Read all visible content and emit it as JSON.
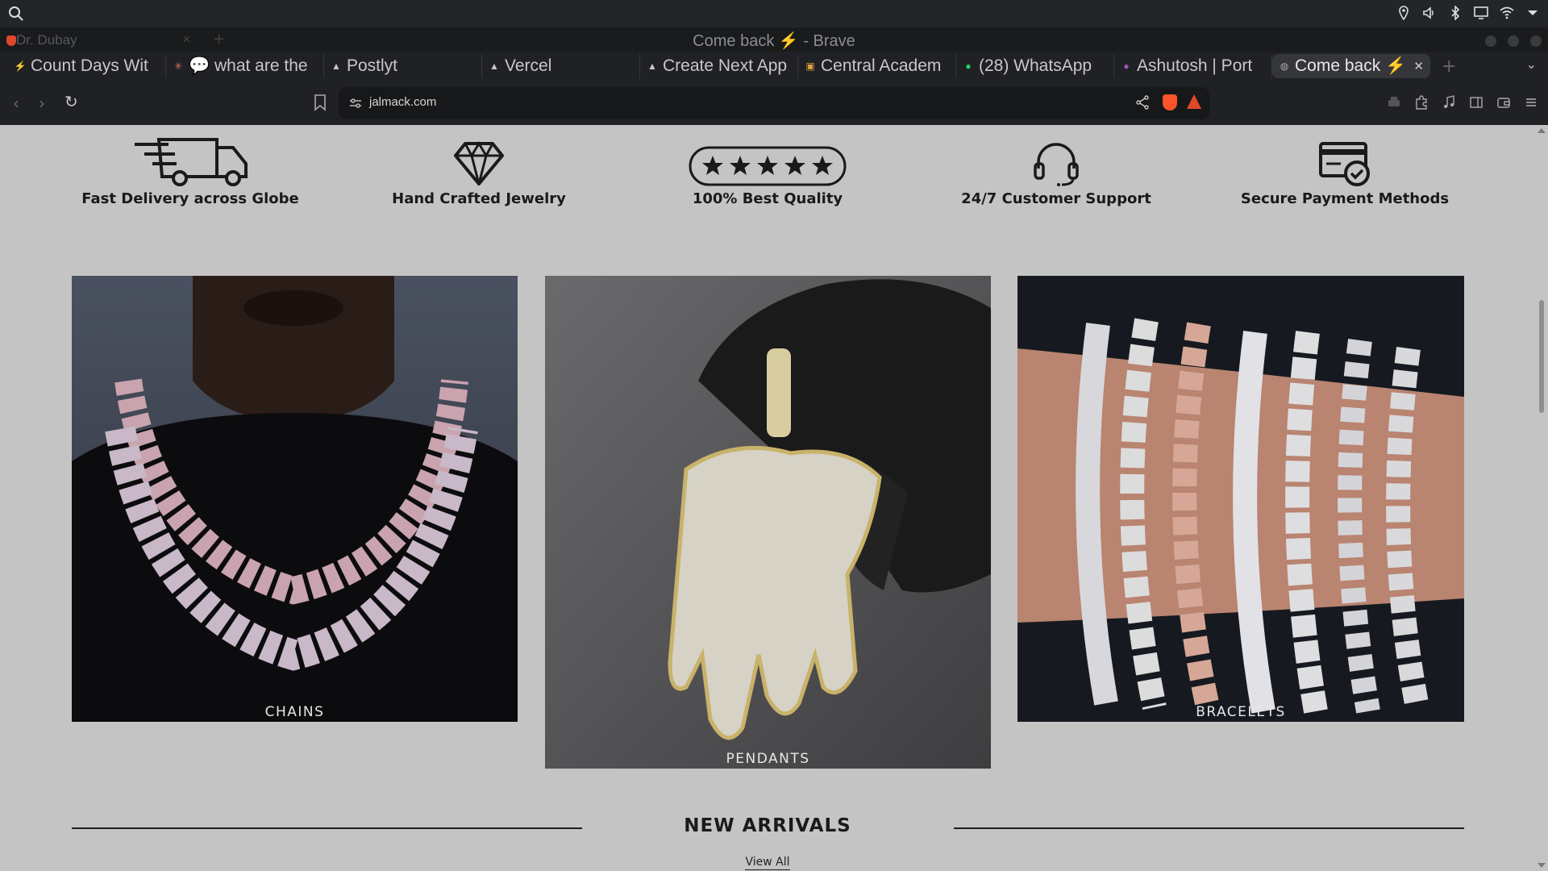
{
  "browser": {
    "window_title": "Come back ⚡ - Brave",
    "ghost_tab": "Dr. Dubay",
    "tabs": [
      {
        "label": "Count Days Wit",
        "icon": "count-days-icon"
      },
      {
        "label": "💬 what are the",
        "icon": "claude-icon"
      },
      {
        "label": "Postlyt",
        "icon": "vercel-icon"
      },
      {
        "label": "Vercel",
        "icon": "vercel-icon"
      },
      {
        "label": "Create Next App",
        "icon": "vercel-icon"
      },
      {
        "label": "Central Academ",
        "icon": "academy-icon"
      },
      {
        "label": "(28) WhatsApp",
        "icon": "whatsapp-icon"
      },
      {
        "label": "Ashutosh | Port",
        "icon": "portfolio-icon"
      },
      {
        "label": "Come back ⚡",
        "icon": "jalmack-icon",
        "active": true
      }
    ],
    "url": "jalmack.com"
  },
  "features": [
    {
      "label": "Fast Delivery across Globe",
      "icon": "delivery-truck-icon"
    },
    {
      "label": "Hand Crafted Jewelry",
      "icon": "diamond-icon"
    },
    {
      "label": "100% Best Quality",
      "icon": "five-stars-icon"
    },
    {
      "label": "24/7 Customer Support",
      "icon": "headset-icon"
    },
    {
      "label": "Secure Payment Methods",
      "icon": "secure-payment-icon"
    }
  ],
  "categories": [
    {
      "label": "CHAINS"
    },
    {
      "label": "PENDANTS"
    },
    {
      "label": "BRACELETS"
    }
  ],
  "new_arrivals": {
    "title": "NEW ARRIVALS",
    "view_all": "View All"
  }
}
